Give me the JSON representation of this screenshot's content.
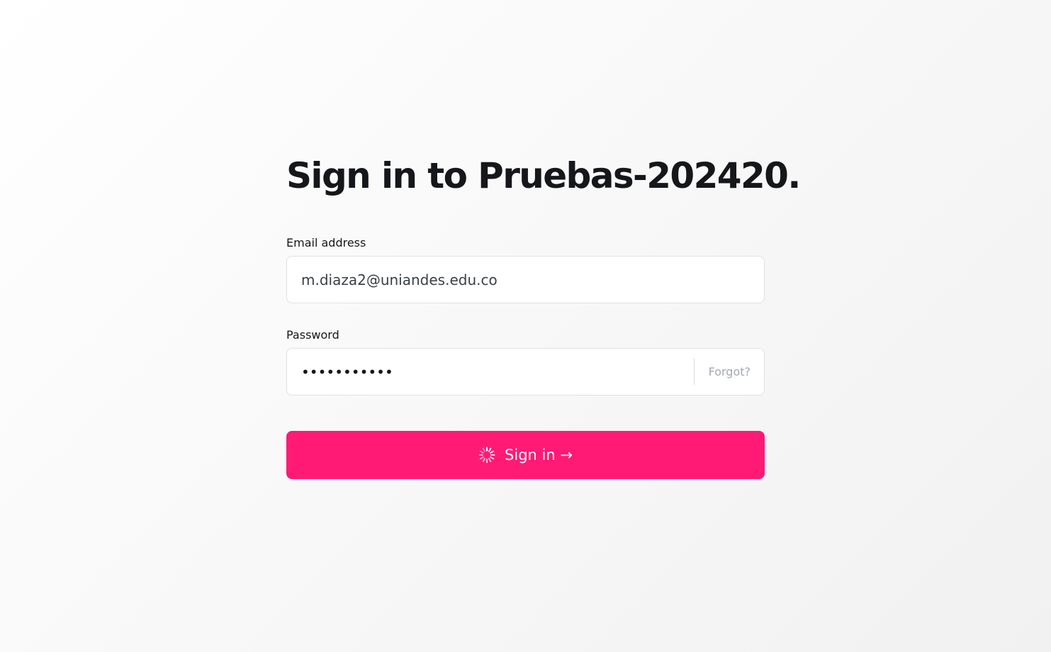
{
  "page": {
    "title": "Sign in to Pruebas-202420."
  },
  "form": {
    "email_label": "Email address",
    "email_value": "m.diaza2@uniandes.edu.co",
    "password_label": "Password",
    "password_masked": "•••••••••••",
    "forgot_label": "Forgot?",
    "signin_label": "Sign in →",
    "signin_state": "loading"
  },
  "icons": {
    "spinner": "loading-spinner-icon"
  },
  "colors": {
    "accent": "#ff1a75",
    "title_text": "#15171a",
    "muted_text": "#a3a9af",
    "input_border": "#e1e1e1"
  }
}
